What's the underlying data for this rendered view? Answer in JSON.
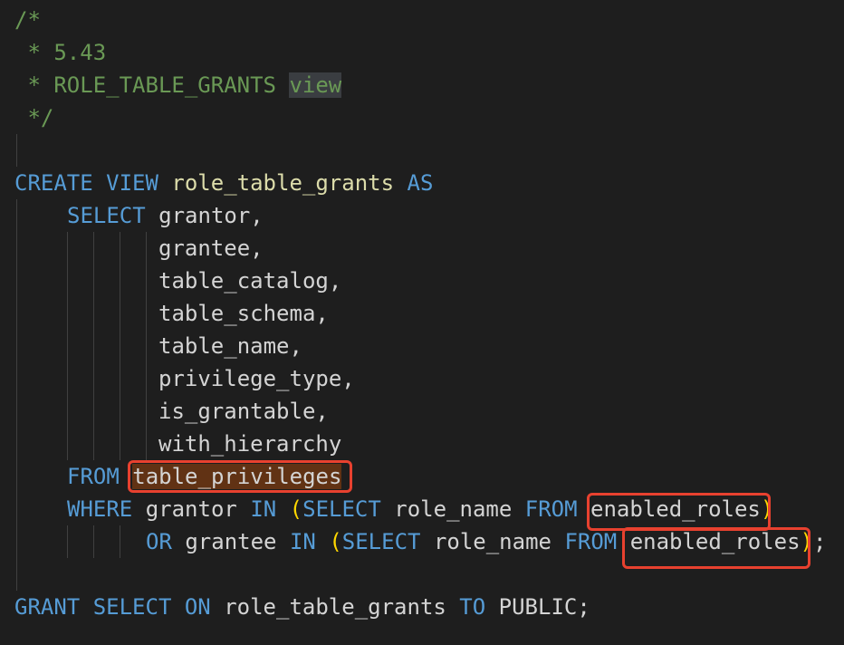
{
  "editor": {
    "language": "sql",
    "colors": {
      "background": "#1e1e1e",
      "comment": "#6a9955",
      "keyword": "#569cd6",
      "identifier": "#dcdcaa",
      "text": "#d4d4d4",
      "bracket": "#ffd700",
      "highlight_box": "#e8412f"
    },
    "lines": {
      "l1": "/*",
      "l2": " * 5.43",
      "l3a": " * ROLE_TABLE_GRANTS ",
      "l3b": "view",
      "l4": " */",
      "create_kw": "CREATE VIEW",
      "create_name": "role_table_grants",
      "as_kw": "AS",
      "select_kw": "SELECT",
      "col_grantor": "grantor,",
      "col_grantee": "grantee,",
      "col_table_catalog": "table_catalog,",
      "col_table_schema": "table_schema,",
      "col_table_name": "table_name,",
      "col_privilege_type": "privilege_type,",
      "col_is_grantable": "is_grantable,",
      "col_with_hierarchy": "with_hierarchy",
      "from_kw": "FROM",
      "from_table": "table_privileges",
      "where_kw": "WHERE",
      "where_col": "grantor",
      "in_kw": "IN",
      "open_paren": "(",
      "sub_select_kw": "SELECT",
      "sub_col": "role_name",
      "sub_from_kw": "FROM",
      "sub_table": "enabled_roles",
      "close_paren": ")",
      "or_kw": "OR",
      "or_col": "grantee",
      "semicolon": ";",
      "grant_kw": "GRANT SELECT ON",
      "grant_name": "role_table_grants",
      "to_kw": "TO",
      "public": "PUBLIC;"
    }
  }
}
